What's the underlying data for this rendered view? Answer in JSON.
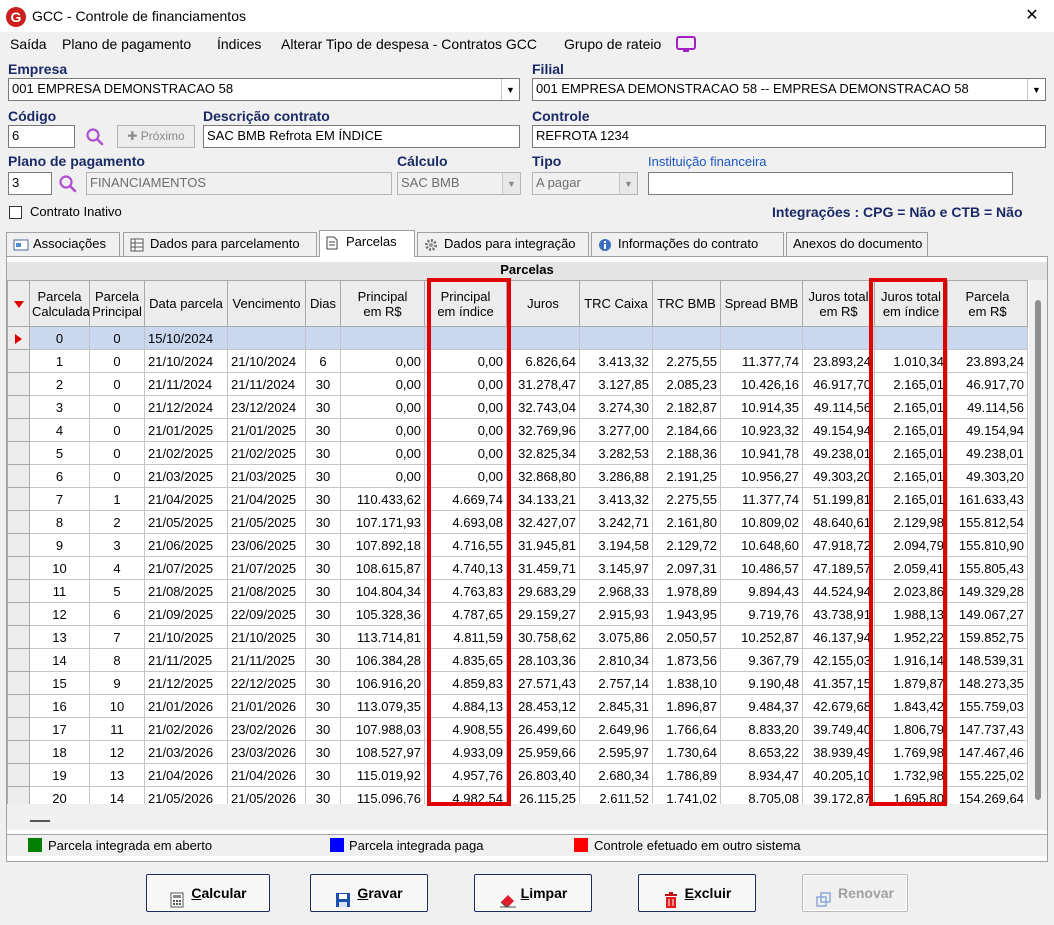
{
  "window": {
    "title": "GCC - Controle de financiamentos",
    "logo_letter": "G",
    "close_glyph": "✕"
  },
  "menu": [
    {
      "label": "Saída"
    },
    {
      "label": "Plano de pagamento"
    },
    {
      "label": "Índices"
    },
    {
      "label": "Alterar Tipo de despesa - Contratos GCC"
    },
    {
      "label": "Grupo de rateio"
    }
  ],
  "form": {
    "empresa_label": "Empresa",
    "empresa_value": "001 EMPRESA DEMONSTRACAO 58",
    "filial_label": "Filial",
    "filial_value": "001 EMPRESA DEMONSTRACAO 58 -- EMPRESA DEMONSTRACAO 58",
    "codigo_label": "Código",
    "codigo_value": "6",
    "proximo_label": "Próximo",
    "descricao_label": "Descrição contrato",
    "descricao_value": "SAC BMB Refrota EM ÍNDICE",
    "controle_label": "Controle",
    "controle_value": "REFROTA 1234",
    "plano_label": "Plano de pagamento",
    "plano_code": "3",
    "plano_value": "FINANCIAMENTOS",
    "calculo_label": "Cálculo",
    "calculo_value": "SAC BMB",
    "tipo_label": "Tipo",
    "tipo_value": "A pagar",
    "instituicao_label": "Instituição financeira",
    "instituicao_value": "",
    "inativo_label": "Contrato Inativo",
    "integracoes_text": "Integrações : CPG = Não e CTB = Não"
  },
  "tabs": [
    {
      "label": "Associações",
      "icon": "associations-icon"
    },
    {
      "label": "Dados para parcelamento",
      "icon": "table-icon"
    },
    {
      "label": "Parcelas",
      "icon": "document-icon",
      "active": true
    },
    {
      "label": "Dados para integração",
      "icon": "gear-icon"
    },
    {
      "label": "Informações do contrato",
      "icon": "info-icon"
    },
    {
      "label": "Anexos do documento",
      "icon": ""
    }
  ],
  "grid": {
    "caption": "Parcelas",
    "columns": [
      [
        "Parcela",
        "Calculada"
      ],
      [
        "Parcela",
        "Principal"
      ],
      [
        "Data parcela"
      ],
      [
        "Vencimento"
      ],
      [
        "Dias"
      ],
      [
        "Principal",
        "em R$"
      ],
      [
        "Principal",
        "em índice"
      ],
      [
        "Juros"
      ],
      [
        "TRC Caixa"
      ],
      [
        "TRC BMB"
      ],
      [
        "Spread BMB"
      ],
      [
        "Juros total",
        "em R$"
      ],
      [
        "Juros total",
        "em índice"
      ],
      [
        "Parcela",
        "em R$"
      ]
    ],
    "rows": [
      [
        "0",
        "0",
        "15/10/2024",
        "",
        "",
        "",
        "",
        "",
        "",
        "",
        "",
        "",
        "",
        ""
      ],
      [
        "1",
        "0",
        "21/10/2024",
        "21/10/2024",
        "6",
        "0,00",
        "0,00",
        "6.826,64",
        "3.413,32",
        "2.275,55",
        "11.377,74",
        "23.893,24",
        "1.010,34",
        "23.893,24"
      ],
      [
        "2",
        "0",
        "21/11/2024",
        "21/11/2024",
        "30",
        "0,00",
        "0,00",
        "31.278,47",
        "3.127,85",
        "2.085,23",
        "10.426,16",
        "46.917,70",
        "2.165,01",
        "46.917,70"
      ],
      [
        "3",
        "0",
        "21/12/2024",
        "23/12/2024",
        "30",
        "0,00",
        "0,00",
        "32.743,04",
        "3.274,30",
        "2.182,87",
        "10.914,35",
        "49.114,56",
        "2.165,01",
        "49.114,56"
      ],
      [
        "4",
        "0",
        "21/01/2025",
        "21/01/2025",
        "30",
        "0,00",
        "0,00",
        "32.769,96",
        "3.277,00",
        "2.184,66",
        "10.923,32",
        "49.154,94",
        "2.165,01",
        "49.154,94"
      ],
      [
        "5",
        "0",
        "21/02/2025",
        "21/02/2025",
        "30",
        "0,00",
        "0,00",
        "32.825,34",
        "3.282,53",
        "2.188,36",
        "10.941,78",
        "49.238,01",
        "2.165,01",
        "49.238,01"
      ],
      [
        "6",
        "0",
        "21/03/2025",
        "21/03/2025",
        "30",
        "0,00",
        "0,00",
        "32.868,80",
        "3.286,88",
        "2.191,25",
        "10.956,27",
        "49.303,20",
        "2.165,01",
        "49.303,20"
      ],
      [
        "7",
        "1",
        "21/04/2025",
        "21/04/2025",
        "30",
        "110.433,62",
        "4.669,74",
        "34.133,21",
        "3.413,32",
        "2.275,55",
        "11.377,74",
        "51.199,81",
        "2.165,01",
        "161.633,43"
      ],
      [
        "8",
        "2",
        "21/05/2025",
        "21/05/2025",
        "30",
        "107.171,93",
        "4.693,08",
        "32.427,07",
        "3.242,71",
        "2.161,80",
        "10.809,02",
        "48.640,61",
        "2.129,98",
        "155.812,54"
      ],
      [
        "9",
        "3",
        "21/06/2025",
        "23/06/2025",
        "30",
        "107.892,18",
        "4.716,55",
        "31.945,81",
        "3.194,58",
        "2.129,72",
        "10.648,60",
        "47.918,72",
        "2.094,79",
        "155.810,90"
      ],
      [
        "10",
        "4",
        "21/07/2025",
        "21/07/2025",
        "30",
        "108.615,87",
        "4.740,13",
        "31.459,71",
        "3.145,97",
        "2.097,31",
        "10.486,57",
        "47.189,57",
        "2.059,41",
        "155.805,43"
      ],
      [
        "11",
        "5",
        "21/08/2025",
        "21/08/2025",
        "30",
        "104.804,34",
        "4.763,83",
        "29.683,29",
        "2.968,33",
        "1.978,89",
        "9.894,43",
        "44.524,94",
        "2.023,86",
        "149.329,28"
      ],
      [
        "12",
        "6",
        "21/09/2025",
        "22/09/2025",
        "30",
        "105.328,36",
        "4.787,65",
        "29.159,27",
        "2.915,93",
        "1.943,95",
        "9.719,76",
        "43.738,91",
        "1.988,13",
        "149.067,27"
      ],
      [
        "13",
        "7",
        "21/10/2025",
        "21/10/2025",
        "30",
        "113.714,81",
        "4.811,59",
        "30.758,62",
        "3.075,86",
        "2.050,57",
        "10.252,87",
        "46.137,94",
        "1.952,22",
        "159.852,75"
      ],
      [
        "14",
        "8",
        "21/11/2025",
        "21/11/2025",
        "30",
        "106.384,28",
        "4.835,65",
        "28.103,36",
        "2.810,34",
        "1.873,56",
        "9.367,79",
        "42.155,03",
        "1.916,14",
        "148.539,31"
      ],
      [
        "15",
        "9",
        "21/12/2025",
        "22/12/2025",
        "30",
        "106.916,20",
        "4.859,83",
        "27.571,43",
        "2.757,14",
        "1.838,10",
        "9.190,48",
        "41.357,15",
        "1.879,87",
        "148.273,35"
      ],
      [
        "16",
        "10",
        "21/01/2026",
        "21/01/2026",
        "30",
        "113.079,35",
        "4.884,13",
        "28.453,12",
        "2.845,31",
        "1.896,87",
        "9.484,37",
        "42.679,68",
        "1.843,42",
        "155.759,03"
      ],
      [
        "17",
        "11",
        "21/02/2026",
        "23/02/2026",
        "30",
        "107.988,03",
        "4.908,55",
        "26.499,60",
        "2.649,96",
        "1.766,64",
        "8.833,20",
        "39.749,40",
        "1.806,79",
        "147.737,43"
      ],
      [
        "18",
        "12",
        "21/03/2026",
        "23/03/2026",
        "30",
        "108.527,97",
        "4.933,09",
        "25.959,66",
        "2.595,97",
        "1.730,64",
        "8.653,22",
        "38.939,49",
        "1.769,98",
        "147.467,46"
      ],
      [
        "19",
        "13",
        "21/04/2026",
        "21/04/2026",
        "30",
        "115.019,92",
        "4.957,76",
        "26.803,40",
        "2.680,34",
        "1.786,89",
        "8.934,47",
        "40.205,10",
        "1.732,98",
        "155.225,02"
      ],
      [
        "20",
        "14",
        "21/05/2026",
        "21/05/2026",
        "30",
        "115.096,76",
        "4.982,54",
        "26.115,25",
        "2.611,52",
        "1.741,02",
        "8.705,08",
        "39.172,87",
        "1.695,80",
        "154.269,64"
      ]
    ]
  },
  "legend": [
    {
      "label": "Parcela integrada em aberto",
      "color": "#008000"
    },
    {
      "label": "Parcela integrada paga",
      "color": "#0000ff"
    },
    {
      "label": "Controle efetuado em outro sistema",
      "color": "#ff0000"
    }
  ],
  "buttons": {
    "calcular": {
      "first": "C",
      "rest": "alcular"
    },
    "gravar": {
      "first": "G",
      "rest": "ravar"
    },
    "limpar": {
      "first": "L",
      "rest": "impar"
    },
    "excluir": {
      "first": "E",
      "rest": "xcluir"
    },
    "renovar": {
      "label": "Renovar"
    }
  },
  "colors": {
    "accent": "#1a2a66",
    "highlight": "#e00000",
    "selected_row": "#c9d7ef"
  }
}
